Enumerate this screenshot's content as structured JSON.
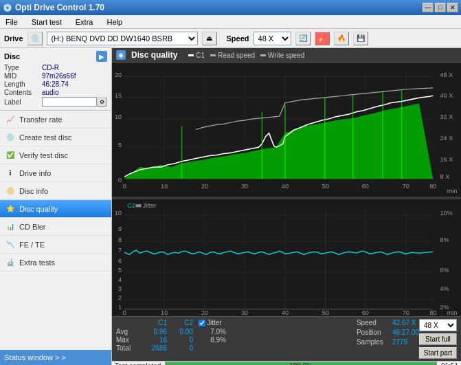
{
  "window": {
    "title": "Opti Drive Control 1.70",
    "icon": "💿"
  },
  "titlebar": {
    "minimize": "—",
    "maximize": "□",
    "close": "✕"
  },
  "menu": {
    "items": [
      "File",
      "Start test",
      "Extra",
      "Help"
    ]
  },
  "drive": {
    "label": "Drive",
    "drive_value": "(H:)  BENQ DVD DD DW1640 BSRB",
    "speed_label": "Speed",
    "speed_value": "48 X"
  },
  "disc": {
    "title": "Disc",
    "type_label": "Type",
    "type_value": "CD-R",
    "mid_label": "MID",
    "mid_value": "97m26s66f",
    "length_label": "Length",
    "length_value": "46:28.74",
    "contents_label": "Contents",
    "contents_value": "audio",
    "label_label": "Label",
    "label_value": ""
  },
  "sidebar": {
    "items": [
      {
        "id": "transfer-rate",
        "label": "Transfer rate",
        "icon": "📈"
      },
      {
        "id": "create-test-disc",
        "label": "Create test disc",
        "icon": "💿"
      },
      {
        "id": "verify-test-disc",
        "label": "Verify test disc",
        "icon": "✅"
      },
      {
        "id": "drive-info",
        "label": "Drive info",
        "icon": "ℹ"
      },
      {
        "id": "disc-info",
        "label": "Disc info",
        "icon": "📀"
      },
      {
        "id": "disc-quality",
        "label": "Disc quality",
        "icon": "⭐",
        "active": true
      },
      {
        "id": "cd-bler",
        "label": "CD Bler",
        "icon": "📊"
      },
      {
        "id": "fe-te",
        "label": "FE / TE",
        "icon": "📉"
      },
      {
        "id": "extra-tests",
        "label": "Extra tests",
        "icon": "🔬"
      }
    ]
  },
  "status_window": {
    "label": "Status window > >"
  },
  "disc_quality": {
    "title": "Disc quality",
    "legend": {
      "c1_label": "C1",
      "read_speed_label": "Read speed",
      "write_speed_label": "Write speed"
    },
    "c2_chart_label": "C2",
    "jitter_label": "Jitter"
  },
  "chart": {
    "top": {
      "y_max": 20,
      "y_min": 0,
      "x_max": 80,
      "right_axis": [
        "48 X",
        "40 X",
        "32 X",
        "24 X",
        "16 X",
        "8 X"
      ]
    },
    "bottom": {
      "y_max": 10,
      "y_min": 1,
      "x_max": 80,
      "right_axis": [
        "10%",
        "8%",
        "6%",
        "4%",
        "2%"
      ]
    }
  },
  "stats": {
    "col_c1": "C1",
    "col_c2": "C2",
    "jitter_label": "Jitter",
    "avg_label": "Avg",
    "avg_c1": "0.96",
    "avg_c2": "0.00",
    "avg_jitter": "7.0%",
    "max_label": "Max",
    "max_c1": "16",
    "max_c2": "0",
    "max_jitter": "8.9%",
    "total_label": "Total",
    "total_c1": "2686",
    "total_c2": "0",
    "speed_label": "Speed",
    "speed_value": "42.67 X",
    "position_label": "Position",
    "position_value": "46:27.00",
    "samples_label": "Samples",
    "samples_value": "2779",
    "speed_select": "48 X",
    "start_full_label": "Start full",
    "start_part_label": "Start part"
  },
  "progress": {
    "label": "Test completed",
    "pct": "100.0%",
    "pct_value": 100,
    "time": "01:51"
  },
  "colors": {
    "c1_line": "#ffffff",
    "c2_line": "#00cccc",
    "green_fill": "#00cc00",
    "accent_blue": "#4a8fd4",
    "active_sidebar": "#1a7adb"
  }
}
